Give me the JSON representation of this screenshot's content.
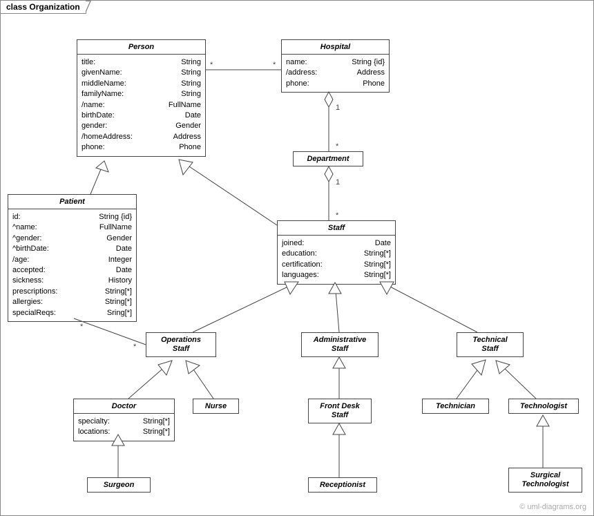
{
  "frame_label": "class Organization",
  "watermark": "© uml-diagrams.org",
  "classes": {
    "person": {
      "name": "Person",
      "attrs": [
        {
          "n": "title:",
          "t": "String"
        },
        {
          "n": "givenName:",
          "t": "String"
        },
        {
          "n": "middleName:",
          "t": "String"
        },
        {
          "n": "familyName:",
          "t": "String"
        },
        {
          "n": "/name:",
          "t": "FullName"
        },
        {
          "n": "birthDate:",
          "t": "Date"
        },
        {
          "n": "gender:",
          "t": "Gender"
        },
        {
          "n": "/homeAddress:",
          "t": "Address"
        },
        {
          "n": "phone:",
          "t": "Phone"
        }
      ]
    },
    "hospital": {
      "name": "Hospital",
      "attrs": [
        {
          "n": "name:",
          "t": "String {id}"
        },
        {
          "n": "/address:",
          "t": "Address"
        },
        {
          "n": "phone:",
          "t": "Phone"
        }
      ]
    },
    "department": {
      "name": "Department"
    },
    "patient": {
      "name": "Patient",
      "attrs": [
        {
          "n": "id:",
          "t": "String {id}"
        },
        {
          "n": "^name:",
          "t": "FullName"
        },
        {
          "n": "^gender:",
          "t": "Gender"
        },
        {
          "n": "^birthDate:",
          "t": "Date"
        },
        {
          "n": "/age:",
          "t": "Integer"
        },
        {
          "n": "accepted:",
          "t": "Date"
        },
        {
          "n": "sickness:",
          "t": "History"
        },
        {
          "n": "prescriptions:",
          "t": "String[*]"
        },
        {
          "n": "allergies:",
          "t": "String[*]"
        },
        {
          "n": "specialReqs:",
          "t": "Sring[*]"
        }
      ]
    },
    "staff": {
      "name": "Staff",
      "attrs": [
        {
          "n": "joined:",
          "t": "Date"
        },
        {
          "n": "education:",
          "t": "String[*]"
        },
        {
          "n": "certification:",
          "t": "String[*]"
        },
        {
          "n": "languages:",
          "t": "String[*]"
        }
      ]
    },
    "ops_staff": {
      "name": "OperationsStaff",
      "lines": [
        "Operations",
        "Staff"
      ]
    },
    "admin_staff": {
      "name": "AdministrativeStaff",
      "lines": [
        "Administrative",
        "Staff"
      ]
    },
    "tech_staff": {
      "name": "TechnicalStaff",
      "lines": [
        "Technical",
        "Staff"
      ]
    },
    "doctor": {
      "name": "Doctor",
      "attrs": [
        {
          "n": "specialty:",
          "t": "String[*]"
        },
        {
          "n": "locations:",
          "t": "String[*]"
        }
      ]
    },
    "nurse": {
      "name": "Nurse"
    },
    "frontdesk": {
      "name": "FrontDeskStaff",
      "lines": [
        "Front Desk",
        "Staff"
      ]
    },
    "receptionist": {
      "name": "Receptionist"
    },
    "technician": {
      "name": "Technician"
    },
    "technologist": {
      "name": "Technologist"
    },
    "surgtech": {
      "name": "SurgicalTechnologist",
      "lines": [
        "Surgical",
        "Technologist"
      ]
    },
    "surgeon": {
      "name": "Surgeon"
    }
  },
  "mult": {
    "person_hospital_left": "*",
    "person_hospital_right": "*",
    "hosp_dept_top": "1",
    "hosp_dept_bot": "*",
    "dept_staff_top": "1",
    "dept_staff_bot": "*",
    "patient_ops_left": "*",
    "patient_ops_right": "*"
  }
}
